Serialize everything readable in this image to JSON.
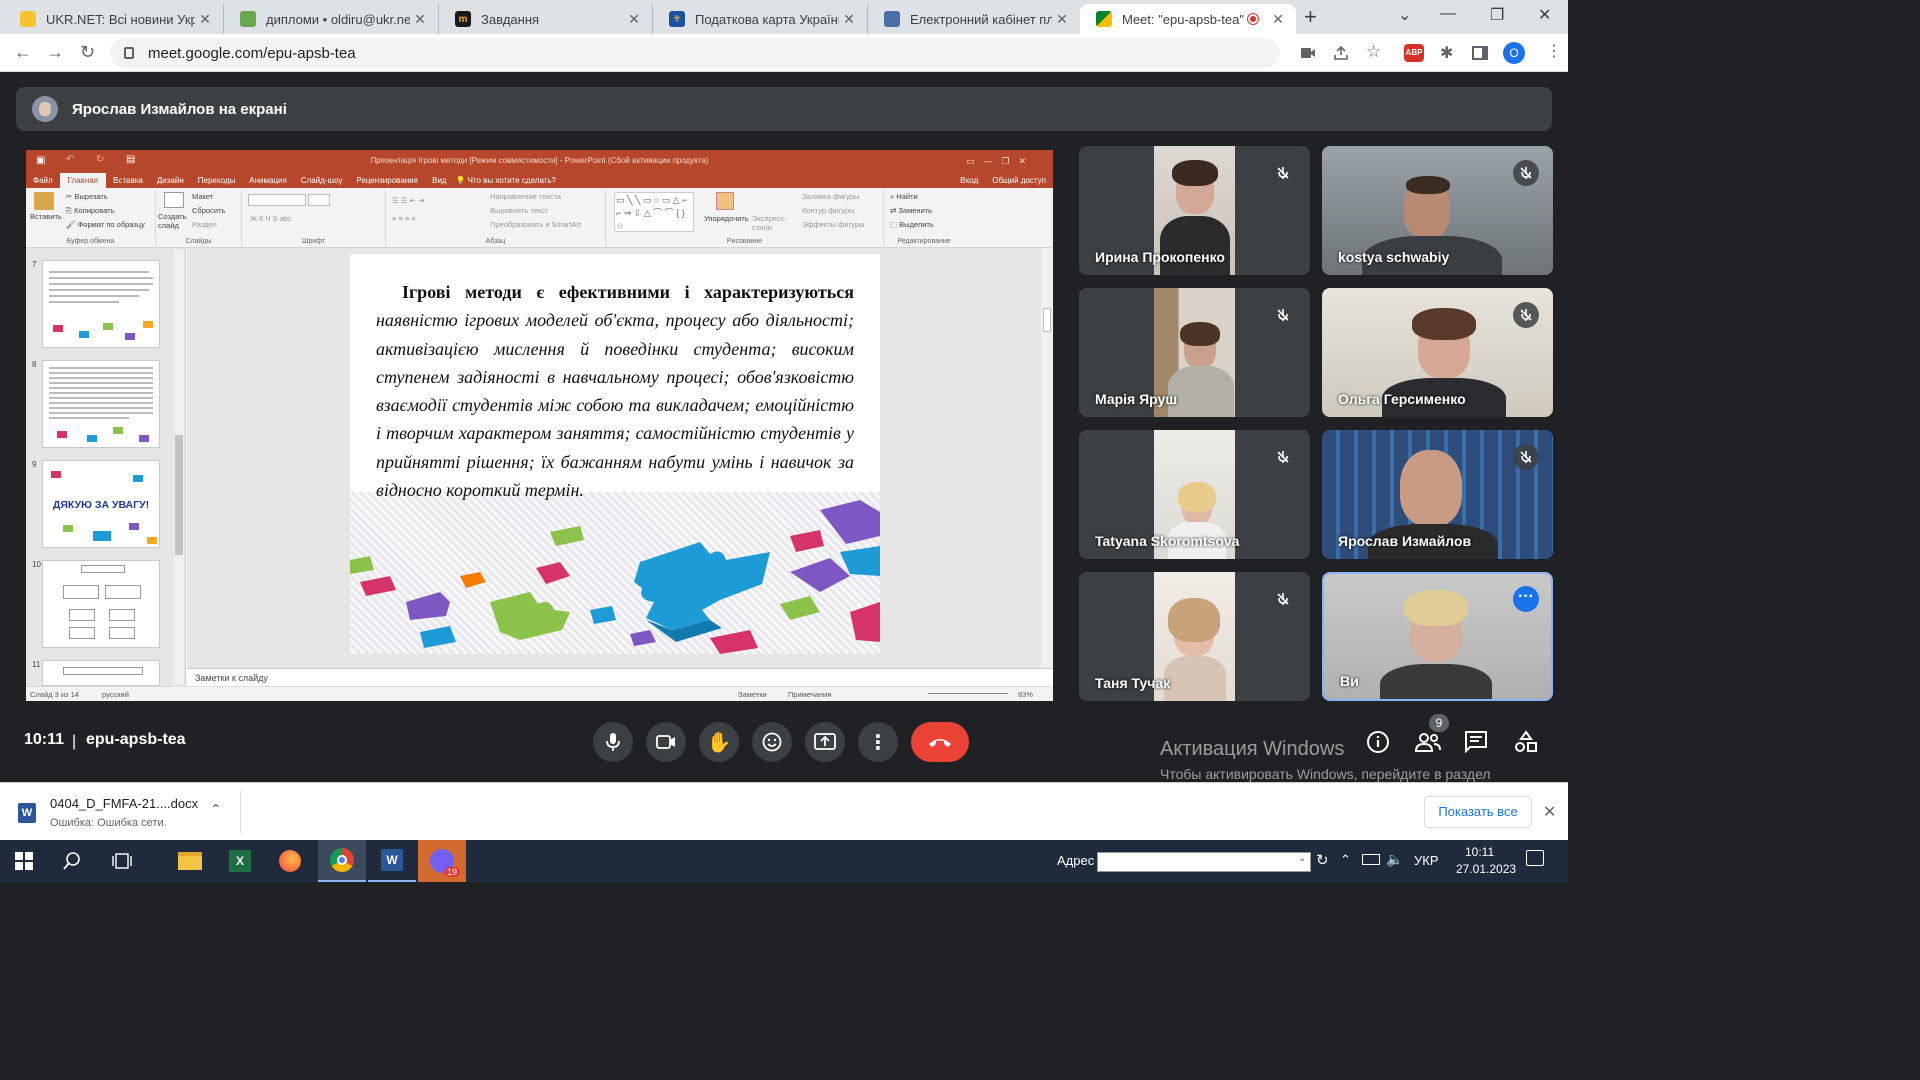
{
  "browser": {
    "tabs": [
      {
        "title": "UKR.NET: Всі новини Украї",
        "icon": "ukrnet-icon",
        "color": "#f4c430"
      },
      {
        "title": "дипломи • oldiru@ukr.net",
        "icon": "mail-icon",
        "color": "#6aa84f"
      },
      {
        "title": "Завдання",
        "icon": "moodle-icon",
        "color": "#1a1a1a"
      },
      {
        "title": "Податкова карта України -",
        "icon": "tax-icon",
        "color": "#1e4fa1"
      },
      {
        "title": "Електронний кабінет плат",
        "icon": "doc-icon",
        "color": "#4a6fa5"
      },
      {
        "title": "Meet: \"epu-apsb-tea\"",
        "icon": "meet-icon",
        "color": "#00897b"
      }
    ],
    "url": "meet.google.com/epu-apsb-tea",
    "profile_initial": "O",
    "abp_label": "ABP"
  },
  "meet": {
    "presenter_banner": "Ярослав Измайлов на екрані",
    "participants": [
      {
        "name": "Ирина Прокопенко",
        "muted": true
      },
      {
        "name": "kostya schwabiy",
        "muted": true
      },
      {
        "name": "Марія Яруш",
        "muted": true
      },
      {
        "name": "Ольга Герсименко",
        "muted": true
      },
      {
        "name": "Tatyana Skoromtsova",
        "muted": true
      },
      {
        "name": "Ярослав Измайлов",
        "muted": true
      },
      {
        "name": "Таня Тучак",
        "muted": true
      },
      {
        "name": "Ви",
        "muted": false
      }
    ],
    "time": "10:11",
    "separator": "|",
    "meeting_code": "epu-apsb-tea",
    "people_count": "9",
    "windows_activation_title": "Активация Windows",
    "windows_activation_text": "Чтобы активировать Windows, перейдите в раздел \"Параметры\"."
  },
  "ppt": {
    "window_title": "Презентація Ігрові методи [Режим совместимости] - PowerPoint (Сбой активации продукта)",
    "tabs": [
      "Файл",
      "Главная",
      "Вставка",
      "Дизайн",
      "Переходы",
      "Анимация",
      "Слайд-шоу",
      "Рецензирование",
      "Вид",
      "Что вы хотите сделать?"
    ],
    "tabs_right": [
      "Вход",
      "Общий доступ"
    ],
    "ribbon": {
      "paste": "Вставить",
      "cut": "Вырезать",
      "copy": "Копировать",
      "format_painter": "Формат по образцу",
      "clipboard": "Буфер обмена",
      "new_slide": "Создать слайд",
      "layout": "Макет",
      "reset": "Сбросить",
      "section": "Раздел",
      "slides": "Слайды",
      "font": "Шрифт",
      "text_direction": "Направление текста",
      "align_text": "Выровнять текст",
      "smartart": "Преобразовать в SmartArt",
      "paragraph": "Абзац",
      "arrange": "Упорядочить",
      "quick_styles": "Экспресс-стили",
      "shape_fill": "Заливка фигуры",
      "shape_outline": "Контур фигуры",
      "shape_effects": "Эффекты фигуры",
      "drawing": "Рисование",
      "find": "Найти",
      "replace": "Заменить",
      "select": "Выделить",
      "editing": "Редактирование"
    },
    "thumb_numbers": [
      "7",
      "8",
      "9",
      "10",
      "11"
    ],
    "thumb_thanks": "ДЯКУЮ ЗА УВАГУ!",
    "slide": {
      "bold_part": "Ігрові методи є ефективними і характеризуються",
      "italic_part": " наявністю ігрових моделей об'єкта, процесу або діяльності; активізацією мислення й поведінки студента; високим ступенем задіяності в навчальному процесі; обов'язковістю взаємодії студентів між собою та викладачем; емоційністю і творчим характером заняття; самостійністю студентів у прийнятті рішення; їх бажанням набути умінь і навичок за відносно короткий термін."
    },
    "notes_placeholder": "Заметки к слайду",
    "status_slide": "Слайд 3 из 14",
    "status_lang": "русский",
    "status_notes": "Заметки",
    "status_comments": "Примечания",
    "zoom": "83%"
  },
  "download": {
    "file_name": "0404_D_FMFA-21....docx",
    "status": "Ошибка: Ошибка сети.",
    "show_all": "Показать все"
  },
  "taskbar": {
    "address_label": "Адрес",
    "lang": "УКР",
    "time": "10:11",
    "date": "27.01.2023",
    "viber_badge": "19"
  }
}
